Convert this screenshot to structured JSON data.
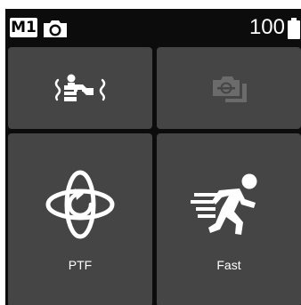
{
  "status_bar": {
    "mode": "M1",
    "camera_icon": "camera-icon",
    "battery_percent": "100",
    "battery_icon": "battery-icon"
  },
  "tiles": [
    {
      "icon": "gimbal-follow-icon",
      "label": "",
      "enabled": true
    },
    {
      "icon": "camera-mount-icon",
      "label": "",
      "enabled": false
    },
    {
      "icon": "ptf-rotation-icon",
      "label": "PTF"
    },
    {
      "icon": "fast-runner-icon",
      "label": "Fast"
    }
  ],
  "colors": {
    "background": "#0c0c0c",
    "tile": "#454545",
    "icon": "#ffffff",
    "disabled_icon": "#6b6b6b"
  }
}
